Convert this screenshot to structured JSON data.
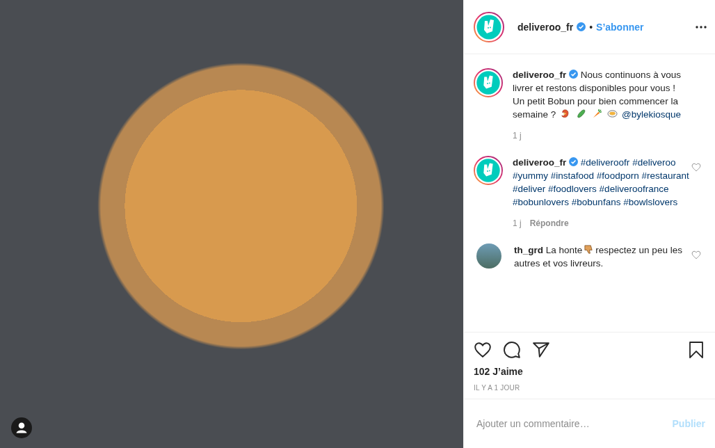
{
  "post": {
    "username": "deliveroo_fr",
    "verified": true,
    "separator": "•",
    "follow": "S’abonner"
  },
  "comments": [
    {
      "kind": "caption",
      "username": "deliveroo_fr",
      "verified": true,
      "text": "Nous continuons à vous livrer et restons disponibles pour vous ! Un petit Bobun pour bien commencer la semaine ?",
      "mention": "@bylekiosque",
      "time": "1 j"
    },
    {
      "kind": "hashtags",
      "username": "deliveroo_fr",
      "verified": true,
      "hashtags": [
        "#deliveroofr",
        "#deliveroo",
        "#yummy",
        "#instafood",
        "#foodporn",
        "#restaurant",
        "#deliver",
        "#foodlovers",
        "#deliveroofrance",
        "#bobunlovers",
        "#bobunfans",
        "#bowlslovers"
      ],
      "time": "1 j",
      "reply": "Répondre",
      "liked": false
    },
    {
      "kind": "text",
      "username": "th_grd",
      "text_before": "La honte",
      "text_after": "respectez un peu les autres et vos livreurs.",
      "liked": false
    }
  ],
  "likes": "102 J’aime",
  "date": "IL Y A 1 JOUR",
  "comment_field": {
    "placeholder": "Ajouter un commentaire…"
  },
  "publish": {
    "label": "Publier",
    "disabled": true
  }
}
